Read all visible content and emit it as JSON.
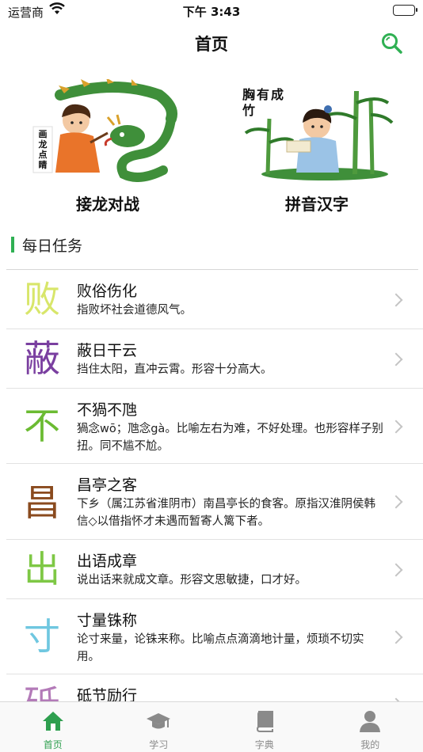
{
  "status_bar": {
    "carrier": "运营商",
    "time": "下午 3:43"
  },
  "nav": {
    "title": "首页",
    "search_icon": "search-icon"
  },
  "features": [
    {
      "label": "接龙对战",
      "art_text": "画龙点睛"
    },
    {
      "label": "拼音汉字",
      "art_text": "胸有成竹"
    }
  ],
  "section": {
    "title": "每日任务",
    "accent": "#2fb053"
  },
  "tasks": [
    {
      "char": "败",
      "color": "#d8e66a",
      "title": "败俗伤化",
      "desc": "指败坏社会道德风气。"
    },
    {
      "char": "蔽",
      "color": "#7a3fa0",
      "title": "蔽日干云",
      "desc": "挡住太阳，直冲云霄。形容十分高大。"
    },
    {
      "char": "不",
      "color": "#6bbb32",
      "title": "不猧不虺",
      "desc": "猧念wō；虺念gà。比喻左右为难，不好处理。也形容样子别扭。同不尴不尬。"
    },
    {
      "char": "昌",
      "color": "#8a4a1e",
      "title": "昌亭之客",
      "desc": "下乡（属江苏省淮阴市）南昌亭长的食客。原指汉淮阴侯韩信◇以借指怀才未遇而暂寄人篱下者。"
    },
    {
      "char": "出",
      "color": "#7ec845",
      "title": "出语成章",
      "desc": "说出话来就成文章。形容文思敏捷，口才好。"
    },
    {
      "char": "寸",
      "color": "#6fc7e0",
      "title": "寸量铢称",
      "desc": "论寸来量，论铢来称。比喻点点滴滴地计量，烦琐不切实用。"
    },
    {
      "char": "砥",
      "color": "#b37ab8",
      "title": "砥节励行",
      "desc": ""
    }
  ],
  "tabs": [
    {
      "label": "首页",
      "icon": "home-icon",
      "active": true
    },
    {
      "label": "学习",
      "icon": "graduation-cap-icon",
      "active": false
    },
    {
      "label": "字典",
      "icon": "book-icon",
      "active": false
    },
    {
      "label": "我的",
      "icon": "person-icon",
      "active": false
    }
  ],
  "colors": {
    "active_tab": "#2e9f4f",
    "inactive_tab": "#8a8a8a"
  }
}
